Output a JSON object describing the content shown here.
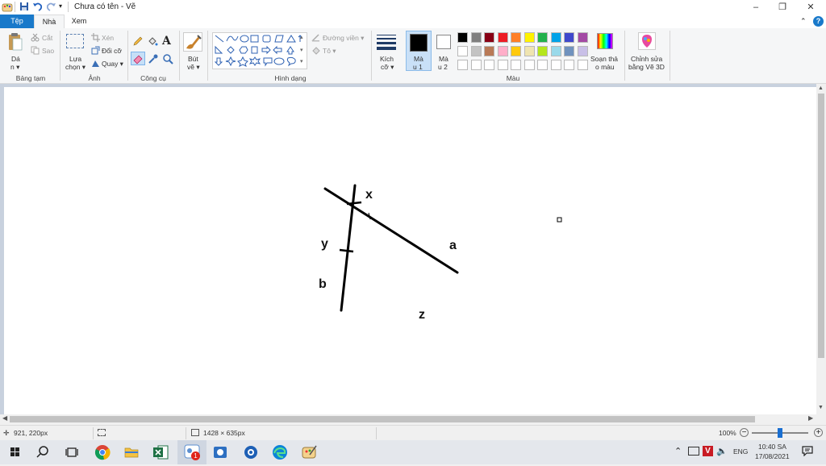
{
  "window": {
    "title": "Chưa có tên - Vẽ",
    "controls": {
      "minimize": "–",
      "restore": "❐",
      "close": "✕"
    }
  },
  "tabs": [
    {
      "label": "Tệp"
    },
    {
      "label": "Nhà"
    },
    {
      "label": "Xem"
    }
  ],
  "help": {
    "label": "?"
  },
  "ribbon": {
    "clipboard": {
      "paste_line1": "Dá",
      "paste_line2": "n ▾",
      "cut": "Cắt",
      "copy": "Sao",
      "group": "Bảng tạm"
    },
    "image": {
      "select_line1": "Lựa",
      "select_line2": "chọn ▾",
      "crop": "Xén",
      "resize": "Đổi cỡ",
      "rotate": "Quay ▾",
      "group": "Ảnh"
    },
    "tools": {
      "group": "Công cụ",
      "text_tool": "A"
    },
    "brushes": {
      "line1": "Bút",
      "line2": "vẽ ▾"
    },
    "shapes": {
      "outline": "Đường viền ▾",
      "fill": "Tô ▾",
      "group": "Hình dạng"
    },
    "size": {
      "line1": "Kích",
      "line2": "cỡ ▾"
    },
    "color1": {
      "line1": "Mà",
      "line2": "u 1",
      "value": "#000000"
    },
    "color2": {
      "line1": "Mà",
      "line2": "u 2",
      "value": "#ffffff"
    },
    "colors": {
      "group": "Màu",
      "row1": [
        "#000000",
        "#7f7f7f",
        "#880015",
        "#ed1c24",
        "#ff7f27",
        "#fff200",
        "#22b14c",
        "#00a2e8",
        "#3f48cc",
        "#a349a4"
      ],
      "row2": [
        "#ffffff",
        "#c3c3c3",
        "#b97a57",
        "#ffaec9",
        "#ffc90e",
        "#efe4b0",
        "#b5e61d",
        "#99d9ea",
        "#7092be",
        "#c8bfe7"
      ],
      "row3": [
        "#ffffff",
        "#ffffff",
        "#ffffff",
        "#ffffff",
        "#ffffff",
        "#ffffff",
        "#ffffff",
        "#ffffff",
        "#ffffff",
        "#ffffff"
      ]
    },
    "edit_colors": {
      "line1": "Soạn thả",
      "line2": "o màu"
    },
    "paint3d": {
      "line1": "Chỉnh sửa",
      "line2": "bằng Vẽ 3D"
    }
  },
  "canvas": {
    "labels": {
      "x": "x",
      "y": "y",
      "a": "a",
      "b": "b",
      "z": "z"
    }
  },
  "status": {
    "cursor_pos": "921, 220px",
    "canvas_size": "1428 × 635px",
    "zoom": "100%",
    "zoom_level": 1.0
  },
  "taskbar": {
    "badge": "1",
    "lang": "ENG",
    "time": "10:40 SA",
    "date": "17/08/2021"
  }
}
